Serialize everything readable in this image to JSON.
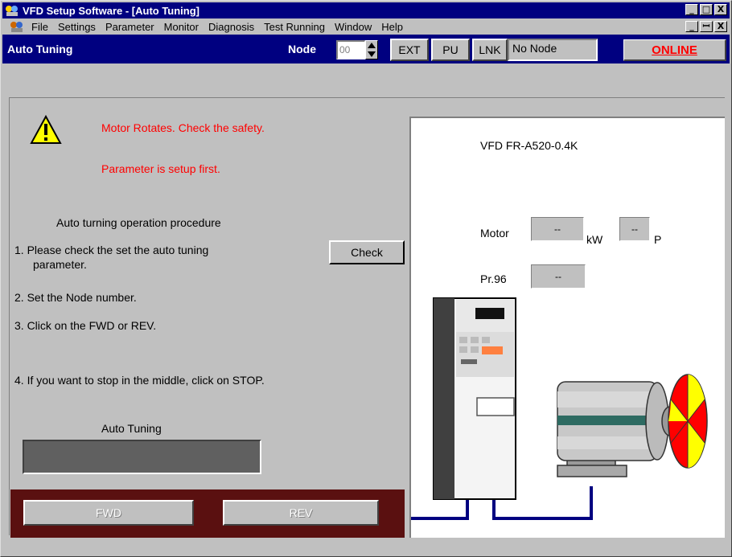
{
  "window": {
    "title": "VFD Setup Software - [Auto Tuning]",
    "controls": {
      "minimize": "_",
      "maximize": "□",
      "close": "X",
      "restore": "ꟷ"
    }
  },
  "menu": {
    "items": [
      "File",
      "Settings",
      "Parameter",
      "Monitor",
      "Diagnosis",
      "Test Running",
      "Window",
      "Help"
    ]
  },
  "toolbar": {
    "title": "Auto Tuning",
    "node_label": "Node",
    "node_value": "00",
    "ext_label": "EXT",
    "pu_label": "PU",
    "lnk_label": "LNK",
    "status_text": "No Node",
    "online_label": "ONLINE"
  },
  "left": {
    "warning_1": "Motor Rotates. Check the safety.",
    "warning_2": "Parameter is setup first.",
    "procedure_title": "Auto turning operation procedure",
    "step_1a": "1. Please check the set the auto tuning",
    "step_1b": "parameter.",
    "step_2": "2. Set the Node number.",
    "step_3": "3. Click on the FWD or REV.",
    "step_4": "4. If you want to stop in the middle, click on STOP.",
    "check_button": "Check",
    "progress_label": "Auto Tuning",
    "progress_value": 0,
    "fwd_button": "FWD",
    "rev_button": "REV"
  },
  "panel": {
    "model": "VFD  FR-A520-0.4K",
    "motor_label": "Motor",
    "motor_kw_value": "--",
    "kw_unit": "kW",
    "motor_p_value": "--",
    "p_unit": "P",
    "pr96_label": "Pr.96",
    "pr96_value": "--"
  },
  "colors": {
    "title_bar": "#000080",
    "warning_text": "#ff0000",
    "online_text": "#ff0000",
    "bottom_bar": "#5a1010",
    "cable": "#000080"
  }
}
